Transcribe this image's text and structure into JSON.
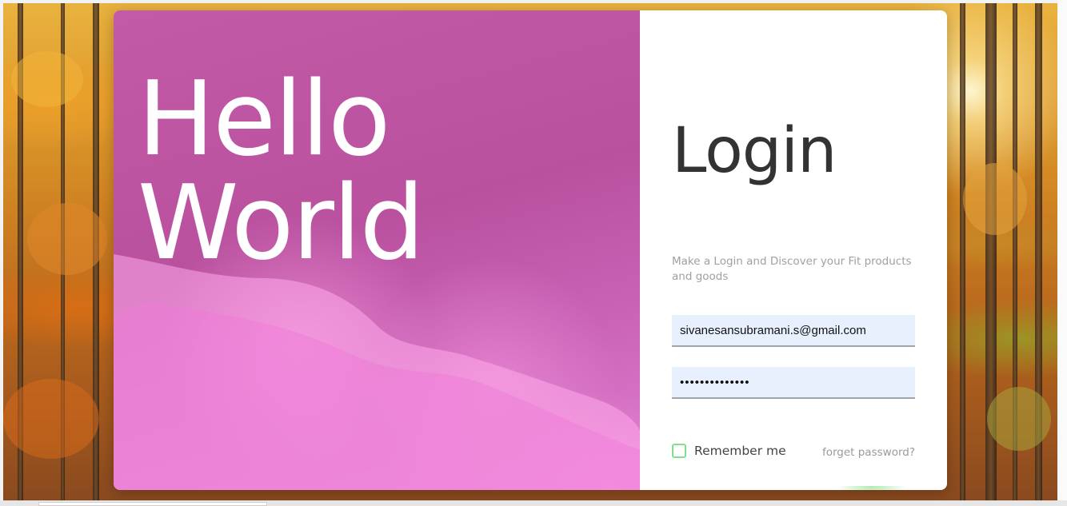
{
  "hero": {
    "line1": "Hello",
    "line2": "World"
  },
  "login": {
    "title": "Login",
    "subtitle": "Make a Login and Discover your Fit products and goods",
    "email_value": "sivanesansubramani.s@gmail.com",
    "password_masked": "••••••••••••••",
    "remember_label": "Remember me",
    "forget_label": "forget password?"
  },
  "colors": {
    "accent_pink": "#c25aa8",
    "checkbox_green": "#7ee08a",
    "title_text": "#333333",
    "muted_text": "#a0a0a0",
    "input_bg": "#e8f0fe"
  },
  "icons": {
    "checkbox": "checkbox-icon"
  }
}
